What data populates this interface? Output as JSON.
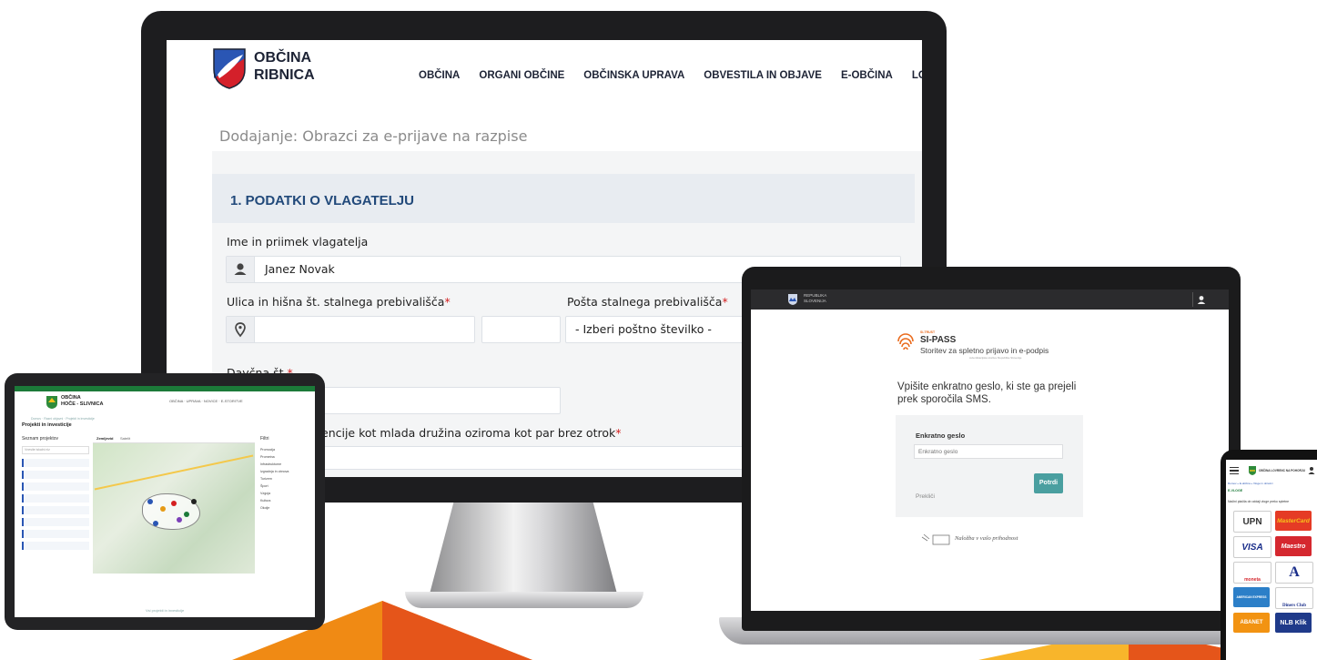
{
  "monitor": {
    "brand_line1": "OBČINA",
    "brand_line2": "RIBNICA",
    "nav": [
      "OBČINA",
      "ORGANI OBČINE",
      "OBČINSKA UPRAVA",
      "OBVESTILA IN OBJAVE",
      "E-OBČINA",
      "LOKA"
    ],
    "page_title": "Dodajanje: Obrazci za e-prijave na razpise",
    "section_title": "1. PODATKI O VLAGATELJU",
    "name_label": "Ime in priimek vlagatelja",
    "name_value": "Janez Novak",
    "street_label": "Ulica in hišna št. stalnega prebivališča",
    "post_label": "Pošta stalnega prebivališča",
    "post_select": "- Izberi poštno številko -",
    "tax_label": "Davčna št.",
    "family_label": "encije kot mlada družina oziroma kot par brez otrok",
    "required_mark": "*",
    "crest_colors": {
      "blue": "#2a56b4",
      "red": "#d4202a"
    }
  },
  "tablet": {
    "brand_line1": "OBČINA",
    "brand_line2": "HOČE - SLIVNICA",
    "breadcrumb": "Domov · Razni objavni · Projekti in investicije",
    "page_heading": "Projekti in investicije",
    "list_heading": "Seznam projektov",
    "search_placeholder": "Vnesite iskalni niz",
    "map_tabs": [
      "Zemljevid",
      "Satelit"
    ],
    "filter_heading": "Filtri",
    "filter_items": [
      "Promocija",
      "Prometna",
      "Infrastrukturne",
      "Izgradnja in obnova",
      "Turizem",
      "Šport",
      "Vzgoja",
      "Kultura",
      "Okolje"
    ],
    "footer_link": "Vsi projekti in investicije"
  },
  "laptop": {
    "gov_line1": "REPUBLIKA",
    "gov_line2": "SLOVENIJA",
    "sipass_tag": "SI-TRUST",
    "sipass_name": "SI-PASS",
    "sipass_sub": "Storitev za spletno prijavo in e-podpis",
    "sipass_fine": "Avtentikacijska storitev Republike Slovenije",
    "instruction": "Vpišite enkratno geslo, ki ste ga prejeli prek sporočila SMS.",
    "otp_label": "Enkratno geslo",
    "otp_placeholder": "Enkratno geslo",
    "cancel_label": "Prekliči",
    "confirm_label": "Potrdi",
    "footer_slogan": "Naložba v vašo prihodnost",
    "accent": "#4a9fa0"
  },
  "phone": {
    "brand": "OBČINA LOVRENC NA POHORJU",
    "breadcrumb": "Domov » E-občina » Vloge in obrazci",
    "section": "E-VLOGE",
    "payment_heading": "Načini plačila ob oddaji vloge preko spletne",
    "payment_methods": [
      "UPN",
      "MasterCard",
      "VISA",
      "Maestro",
      "moneta",
      "A",
      "AMERICAN EXPRESS",
      "Diners Club",
      "ABANET",
      "NLB Klik"
    ]
  }
}
